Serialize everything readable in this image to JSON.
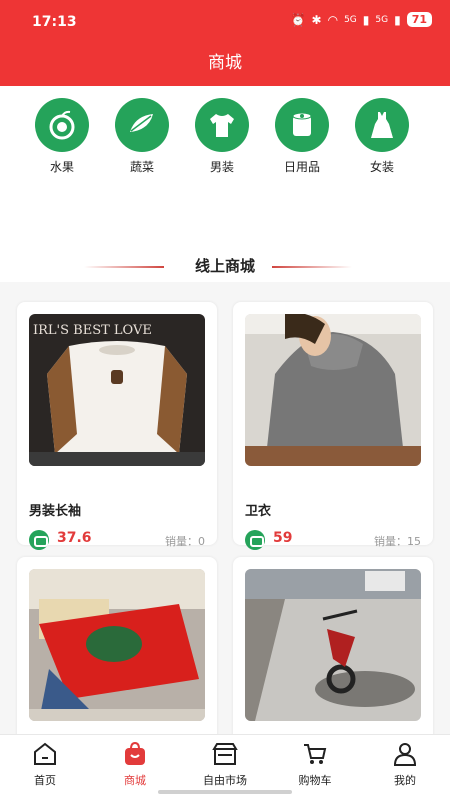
{
  "status": {
    "time": "17:13",
    "signal1": "5G",
    "signal2": "5G",
    "battery": "71"
  },
  "header": {
    "title": "商城"
  },
  "categories": [
    {
      "label": "水果",
      "icon": "fruit-icon"
    },
    {
      "label": "蔬菜",
      "icon": "vegetable-icon"
    },
    {
      "label": "男装",
      "icon": "tshirt-icon"
    },
    {
      "label": "日用品",
      "icon": "tissue-roll-icon"
    },
    {
      "label": "女装",
      "icon": "dress-icon"
    }
  ],
  "section": {
    "title": "线上商城"
  },
  "products": [
    {
      "name": "男装长袖",
      "price": "37.6",
      "sales_label": "销量：",
      "sales": "0"
    },
    {
      "name": "卫衣",
      "price": "59",
      "sales_label": "销量：",
      "sales": "15"
    },
    {
      "name": "",
      "price": "",
      "sales_label": "",
      "sales": ""
    },
    {
      "name": "",
      "price": "",
      "sales_label": "",
      "sales": ""
    }
  ],
  "tabbar": {
    "items": [
      {
        "label": "首页",
        "icon": "home-icon"
      },
      {
        "label": "商城",
        "icon": "shopping-bag-icon"
      },
      {
        "label": "自由市场",
        "icon": "market-stall-icon"
      },
      {
        "label": "购物车",
        "icon": "cart-icon"
      },
      {
        "label": "我的",
        "icon": "person-icon"
      }
    ],
    "active": "商城"
  },
  "colors": {
    "brand_red": "#ee3535",
    "category_green": "#25a35a",
    "price_red": "#e23b3b"
  }
}
